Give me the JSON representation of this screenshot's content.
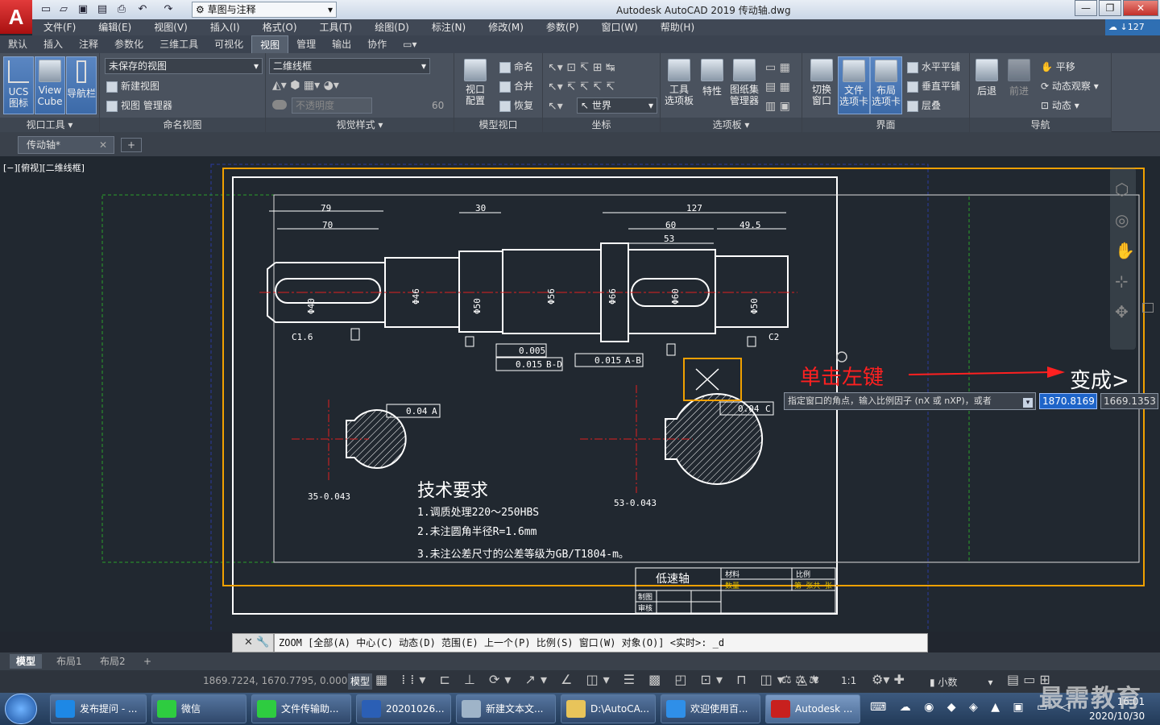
{
  "title_bar": {
    "workspace": "草图与注释",
    "app_title": "Autodesk AutoCAD 2019    传动轴.dwg",
    "logo": "A",
    "sign_in": "127"
  },
  "menu": [
    "文件(F)",
    "编辑(E)",
    "视图(V)",
    "插入(I)",
    "格式(O)",
    "工具(T)",
    "绘图(D)",
    "标注(N)",
    "修改(M)",
    "参数(P)",
    "窗口(W)",
    "帮助(H)"
  ],
  "ribbon_tabs": [
    "默认",
    "插入",
    "注释",
    "参数化",
    "三维工具",
    "可视化",
    "视图",
    "管理",
    "输出",
    "协作"
  ],
  "active_tab": "视图",
  "ribbon": {
    "viewport_tools": {
      "title": "视口工具",
      "ucs": "UCS\n图标",
      "viewcube": "View\nCube",
      "nav": "导航栏"
    },
    "named_views": {
      "title": "命名视图",
      "combo": "未保存的视图",
      "new": "新建视图",
      "manager": "视图 管理器"
    },
    "visual_styles": {
      "title": "视觉样式",
      "combo": "二维线框",
      "opacity_placeholder": "不透明度",
      "opacity_value": "60"
    },
    "model_viewports": {
      "title": "模型视口",
      "config": "视口\n配置",
      "name": "命名",
      "merge": "合并",
      "restore": "恢复"
    },
    "coordinates": {
      "title": "坐标",
      "world": "世界"
    },
    "palettes": {
      "title": "选项板",
      "tools": "工具\n选项板",
      "props": "特性",
      "sheetset": "图纸集\n管理器"
    },
    "interface": {
      "title": "界面",
      "switch": "切换\n窗口",
      "filetab": "文件\n选项卡",
      "layouttab": "布局\n选项卡",
      "htile": "水平平铺",
      "vtile": "垂直平铺",
      "cascade": "层叠"
    },
    "navigate": {
      "title": "导航",
      "back": "后退",
      "forward": "前进",
      "pan": "平移",
      "orbit": "动态观察",
      "dynamic": "动态"
    }
  },
  "doc_tab": "传动轴*",
  "viewport_label": "[−][俯视][二维线框]",
  "drawing": {
    "dims": [
      "79",
      "70",
      "30",
      "127",
      "60",
      "49.5",
      "53",
      "C1.6",
      "C2"
    ],
    "diams": [
      "Φ40",
      "Φ46",
      "Φ50",
      "Φ56",
      "Φ66",
      "Φ60",
      "Φ50"
    ],
    "tol1": "0.005",
    "tol2": "0.015",
    "tol2_ref": "B-D",
    "tol3": "0.015",
    "tol3_ref": "A-B",
    "tol4": "0.04",
    "tol4_ref": "A",
    "tol5": "0.04",
    "tol5_ref": "C",
    "sec1_dim": "35-0.043",
    "sec2_dim": "53-0.043",
    "tech_title": "技术要求",
    "tech_1": "1.调质处理220～250HBS",
    "tech_2": "2.未注圆角半径R=1.6mm",
    "tech_3": "3.未注公差尺寸的公差等级为GB/T1804-m。",
    "tb_name": "低速轴",
    "tb_material": "材料",
    "tb_scale": "比例",
    "tb_qty": "数量",
    "tb_draw": "制图",
    "tb_check": "审核",
    "tb_sheet": "第 张共 张"
  },
  "annotation": {
    "click": "单击左键",
    "becomes": "变成>"
  },
  "tooltip": "指定窗口的角点，输入比例因子 (nX 或 nXP)，或者",
  "inputs": [
    "1870.8169",
    "1669.1353"
  ],
  "command": "ZOOM [全部(A) 中心(C) 动态(D) 范围(E) 上一个(P) 比例(S) 窗口(W) 对象(O)] <实时>: _d",
  "layout_tabs": [
    "模型",
    "布局1",
    "布局2"
  ],
  "coords": "1869.7224, 1670.7795, 0.0000",
  "status_model": "模型",
  "status_units": "小数",
  "status_scale": "1:1",
  "taskbar": [
    {
      "label": "发布提问 - ...",
      "color": "#1e88e5"
    },
    {
      "label": "微信",
      "color": "#2ecc40"
    },
    {
      "label": "文件传输助...",
      "color": "#2ecc40"
    },
    {
      "label": "20201026...",
      "color": "#2b5fb5"
    },
    {
      "label": "新建文本文...",
      "color": "#9fb4c8"
    },
    {
      "label": "D:\\AutoCA...",
      "color": "#e8c45a"
    },
    {
      "label": "欢迎使用百...",
      "color": "#2f8fe8"
    },
    {
      "label": "Autodesk ...",
      "color": "#c8201e"
    }
  ],
  "clock": {
    "time": "16:01",
    "date": "2020/10/30"
  },
  "watermark": "最需教育"
}
